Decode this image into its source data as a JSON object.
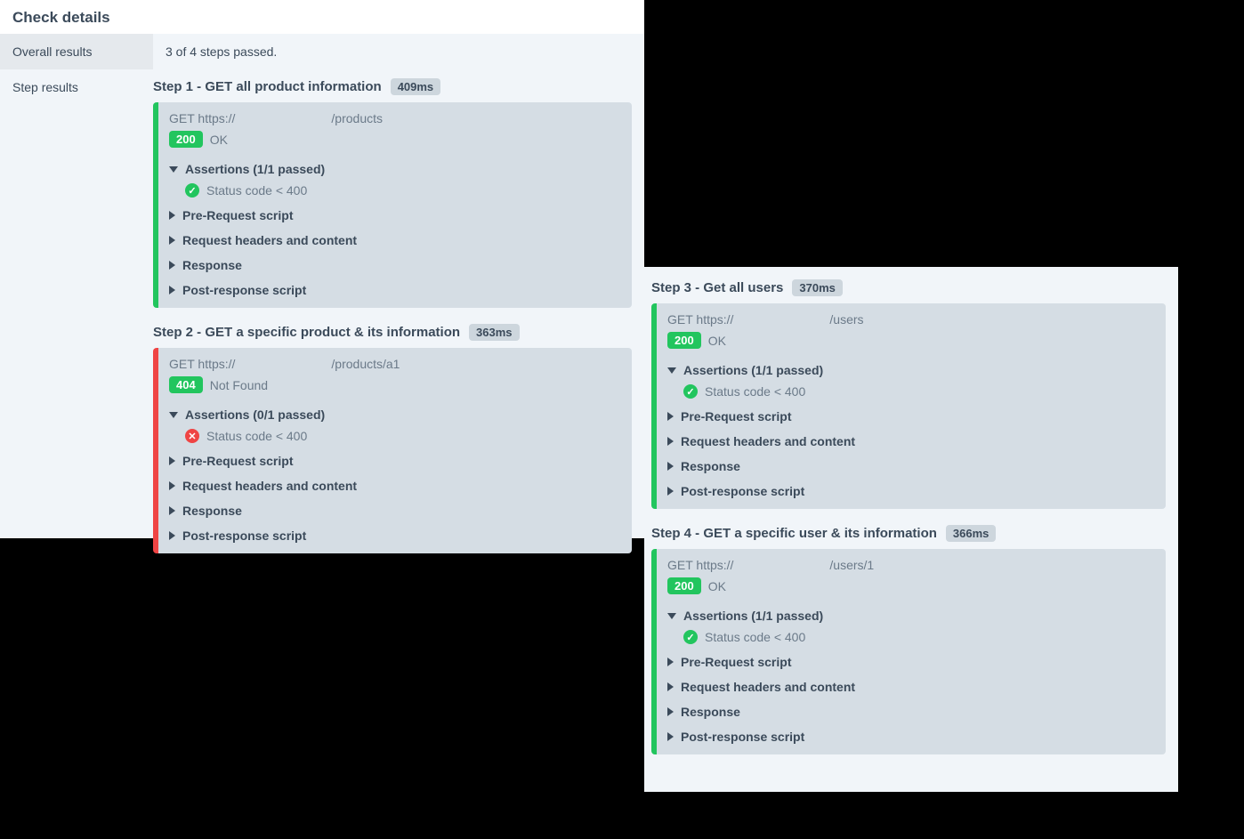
{
  "title": "Check details",
  "sidebar": {
    "overall": "Overall results",
    "steps": "Step results"
  },
  "overall_text": "3 of 4 steps passed.",
  "sections": {
    "assertions_prefix": "Assertions",
    "prerequest": "Pre-Request script",
    "reqheaders": "Request headers and content",
    "response": "Response",
    "postresponse": "Post-response script"
  },
  "left_steps": [
    {
      "title": "Step 1 - GET all product information",
      "duration": "409ms",
      "status": "pass",
      "method": "GET",
      "url_prefix": "https://",
      "url_suffix": "/products",
      "code": "200",
      "code_text": "OK",
      "assertions_summary": "(1/1 passed)",
      "assertion_text": "Status code < 400",
      "assertion_ok": true
    },
    {
      "title": "Step 2 - GET a specific product & its information",
      "duration": "363ms",
      "status": "fail",
      "method": "GET",
      "url_prefix": "https://",
      "url_suffix": "/products/a1",
      "code": "404",
      "code_text": "Not Found",
      "assertions_summary": "(0/1 passed)",
      "assertion_text": "Status code < 400",
      "assertion_ok": false
    }
  ],
  "right_steps": [
    {
      "title": "Step 3 - Get all users",
      "duration": "370ms",
      "status": "pass",
      "method": "GET",
      "url_prefix": "https://",
      "url_suffix": "/users",
      "code": "200",
      "code_text": "OK",
      "assertions_summary": "(1/1 passed)",
      "assertion_text": "Status code < 400",
      "assertion_ok": true
    },
    {
      "title": "Step 4 - GET a specific user & its information",
      "duration": "366ms",
      "status": "pass",
      "method": "GET",
      "url_prefix": "https://",
      "url_suffix": "/users/1",
      "code": "200",
      "code_text": "OK",
      "assertions_summary": "(1/1 passed)",
      "assertion_text": "Status code < 400",
      "assertion_ok": true
    }
  ]
}
